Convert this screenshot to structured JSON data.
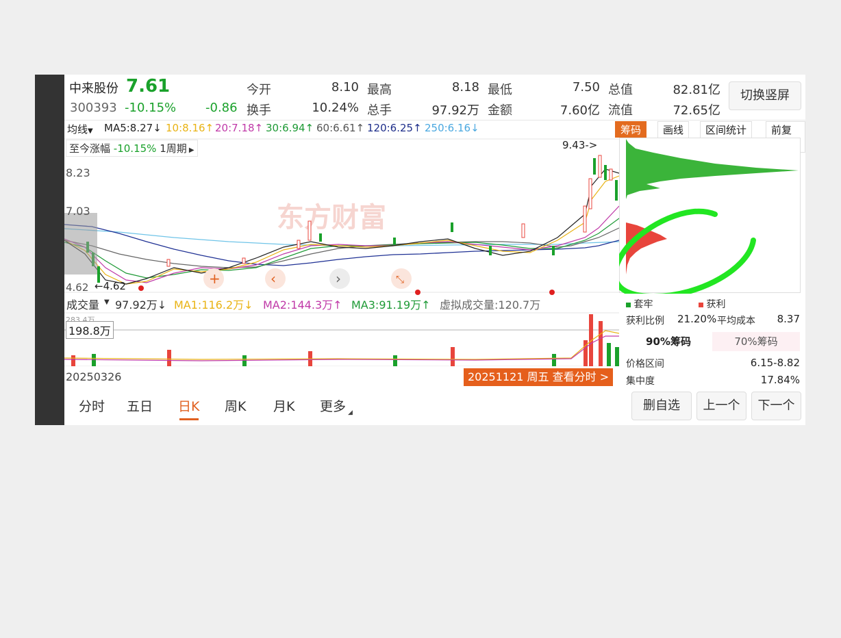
{
  "stock": {
    "name": "中来股份",
    "code": "300393",
    "price": "7.61",
    "change_pct": "-10.15%",
    "change": "-0.86"
  },
  "quote": {
    "open_label": "今开",
    "open": "8.10",
    "high_label": "最高",
    "high": "8.18",
    "low_label": "最低",
    "low": "7.50",
    "mktcap_label": "总值",
    "mktcap": "82.81亿",
    "turnover_label": "换手",
    "turnover": "10.24%",
    "volume_label": "总手",
    "volume": "97.92万",
    "amount_label": "金额",
    "amount": "7.60亿",
    "float_label": "流值",
    "float": "72.65亿"
  },
  "switch_button": "切换竖屏",
  "ma_bar": {
    "selector": "均线",
    "ma5": "MA5:8.27↓",
    "ma10": "10:8.16↑",
    "ma20": "20:7.18↑",
    "ma30": "30:6.94↑",
    "ma60": "60:6.61↑",
    "ma120": "120:6.25↑",
    "ma250": "250:6.16↓"
  },
  "tools": {
    "chips": "筹码",
    "draw": "画线",
    "range_stats": "区间统计",
    "adjust": "前复权"
  },
  "period_info": {
    "label": "至今涨幅",
    "value": "-10.15%",
    "period": "1周期"
  },
  "price_axis": {
    "top": "8.23",
    "mid": "7.03",
    "low": "4.62",
    "low_marker": "4.62",
    "high_marker": "9.43->"
  },
  "volume": {
    "label": "成交量",
    "value": "97.92万↓",
    "ma1": "MA1:116.2万↓",
    "ma2": "MA2:144.3万↑",
    "ma3": "MA3:91.19万↑",
    "virtual": "虚拟成交量:120.7万",
    "axis_top": "283.4万",
    "crosshair": "198.8万"
  },
  "dates": {
    "start": "20250326",
    "selected": "20251121 周五 查看分时 >"
  },
  "chips": {
    "legend_trapped": "套牢",
    "legend_profit": "获利",
    "profit_ratio_label": "获利比例",
    "profit_ratio": "21.20%",
    "avg_cost_label": "平均成本",
    "avg_cost": "8.37",
    "tab90": "90%筹码",
    "tab70": "70%筹码",
    "price_range_label": "价格区间",
    "price_range": "6.15-8.82",
    "concentration_label": "集中度",
    "concentration": "17.84%"
  },
  "tabs": [
    "分时",
    "五日",
    "日K",
    "周K",
    "月K",
    "更多"
  ],
  "actions": {
    "remove": "删自选",
    "prev": "上一个",
    "next": "下一个"
  },
  "watermark": "东方财富",
  "colors": {
    "up": "#e8453c",
    "down": "#1aa12b",
    "accent": "#e06020",
    "annotation": "#22e622"
  }
}
